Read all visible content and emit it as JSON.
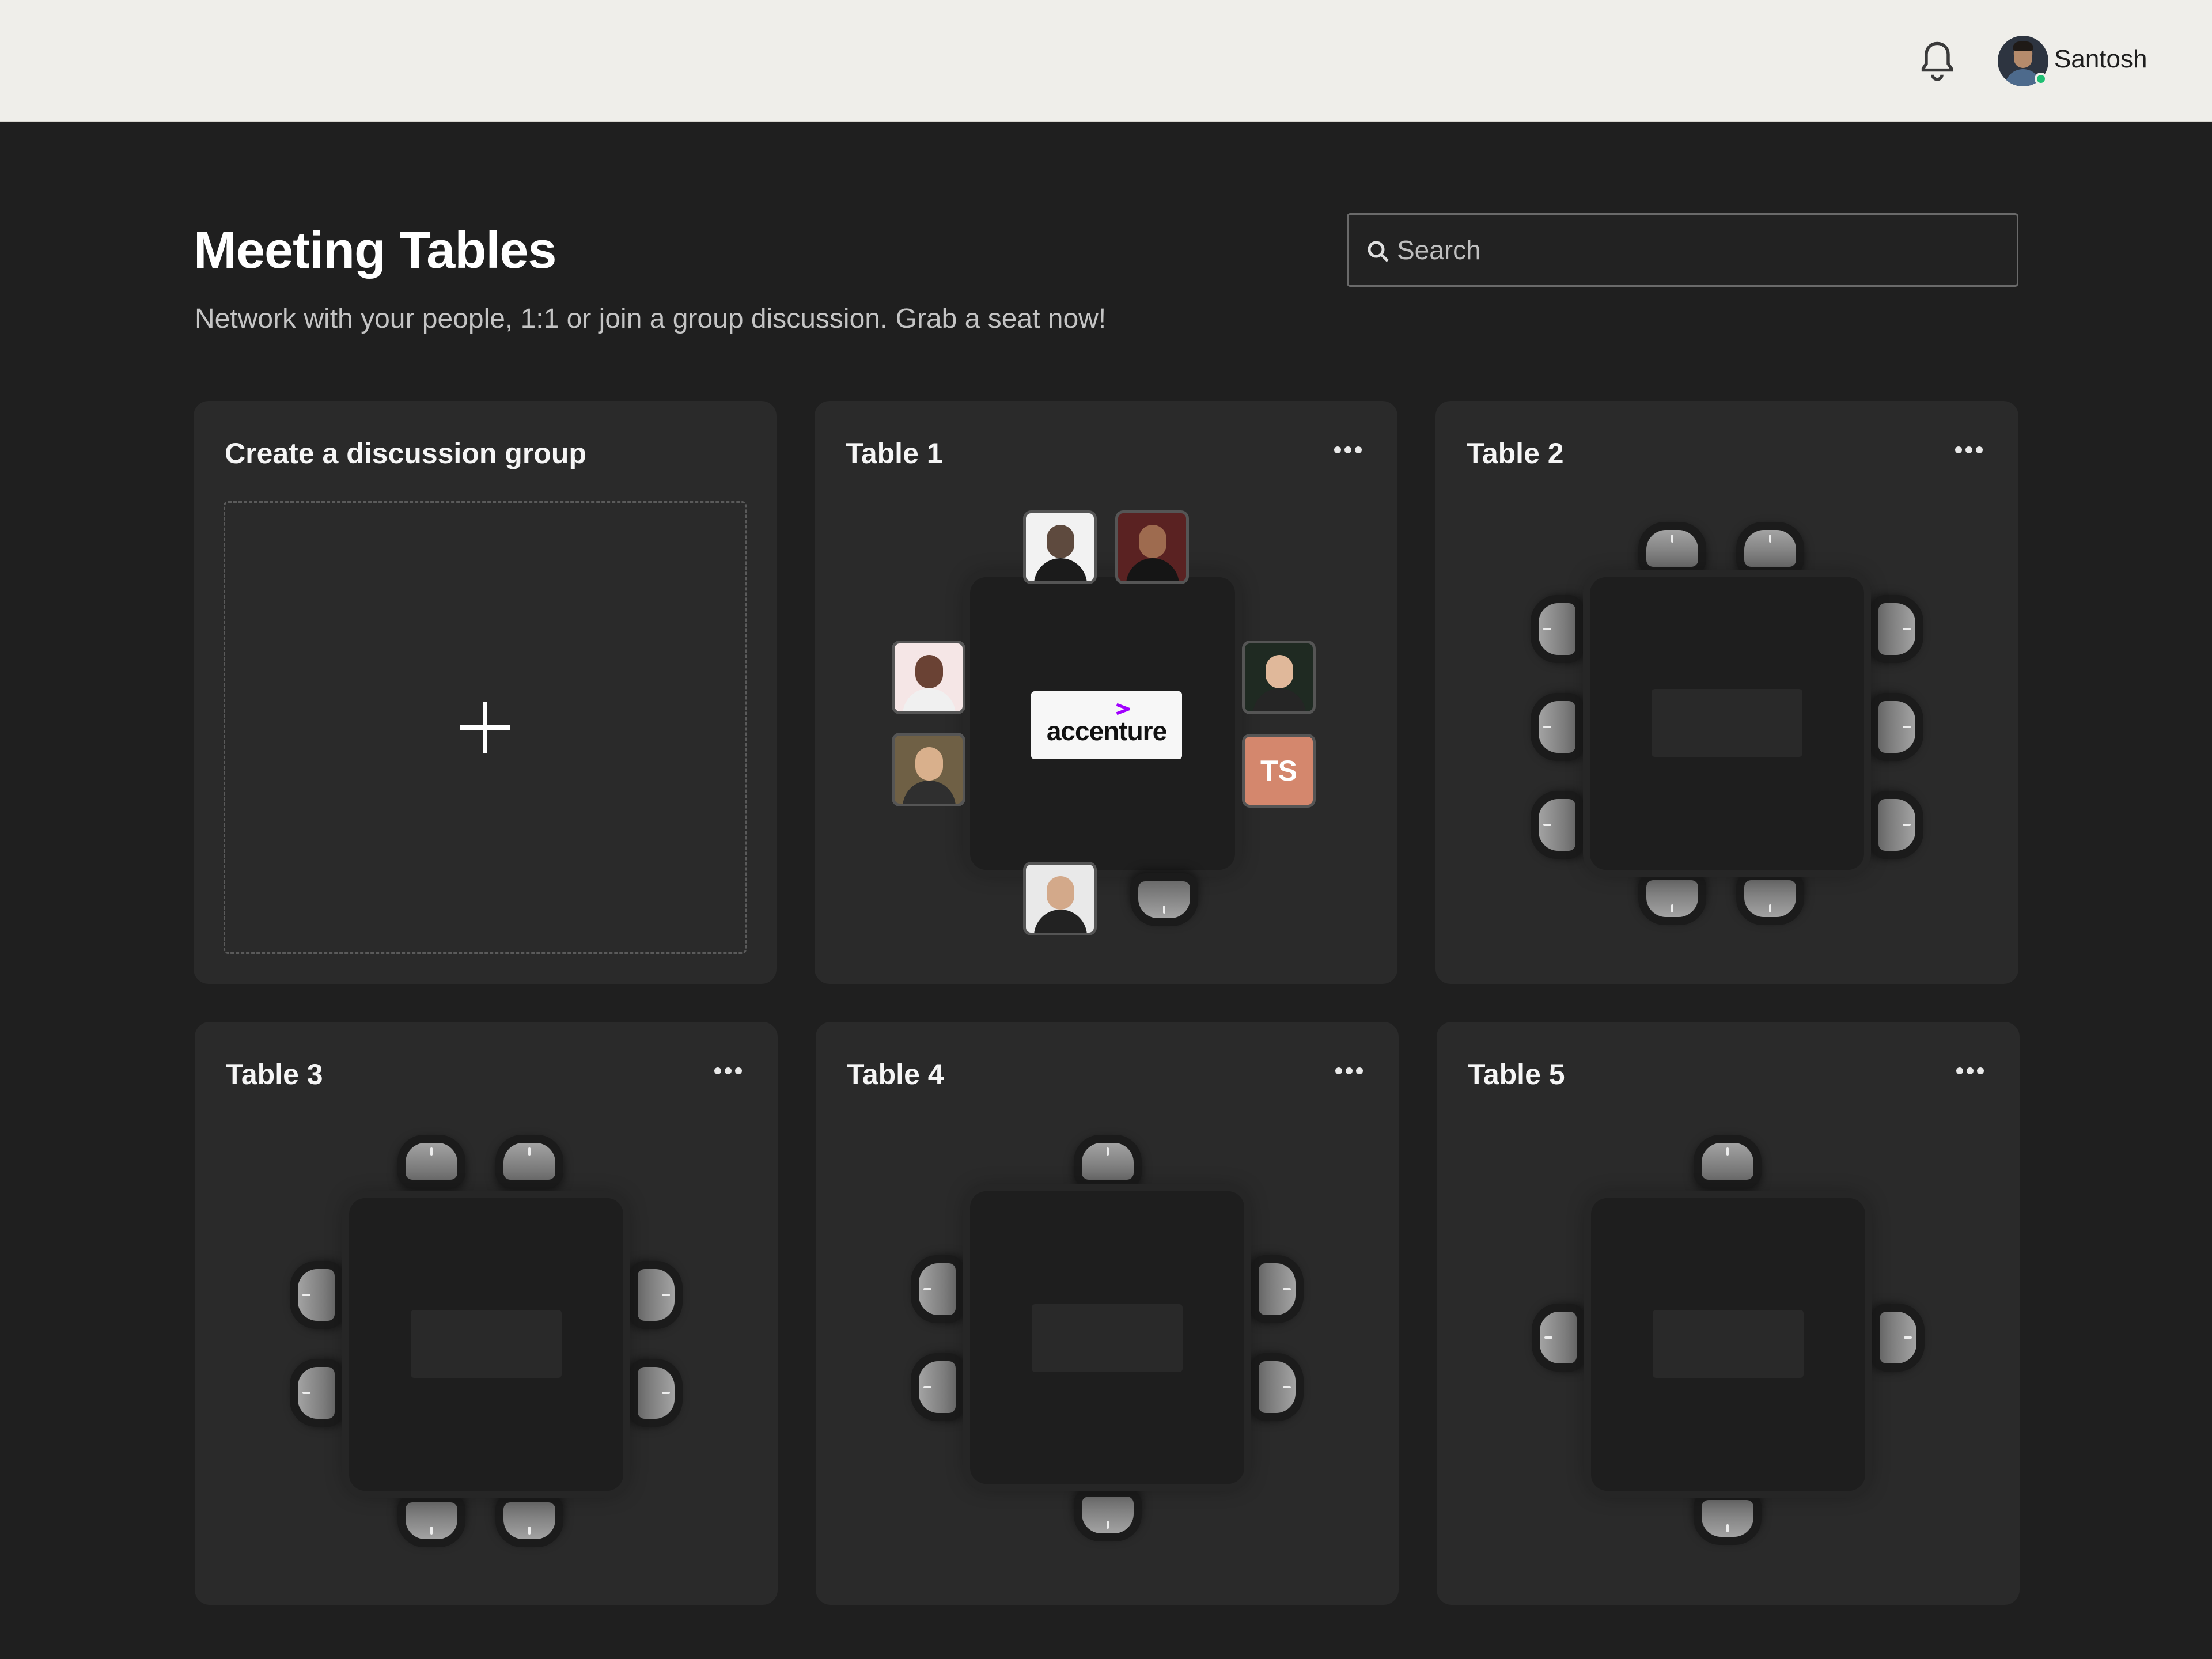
{
  "topbar": {
    "notification_icon": "bell-icon",
    "user": {
      "name": "Santosh",
      "status_color": "#1fbf73"
    }
  },
  "header": {
    "title": "Meeting Tables",
    "subtitle": "Network with your people, 1:1 or join a group discussion. Grab a seat now!",
    "search_placeholder": "Search"
  },
  "create_card": {
    "title": "Create a discussion group",
    "icon": "plus-icon"
  },
  "tables": [
    {
      "title": "Table 1",
      "logo_text": "accenture",
      "logo_accent": "#a100ff",
      "occupant_initials": "TS",
      "occupant_color": "#d4876d"
    },
    {
      "title": "Table 2"
    },
    {
      "title": "Table 3"
    },
    {
      "title": "Table 4"
    },
    {
      "title": "Table 5"
    }
  ]
}
